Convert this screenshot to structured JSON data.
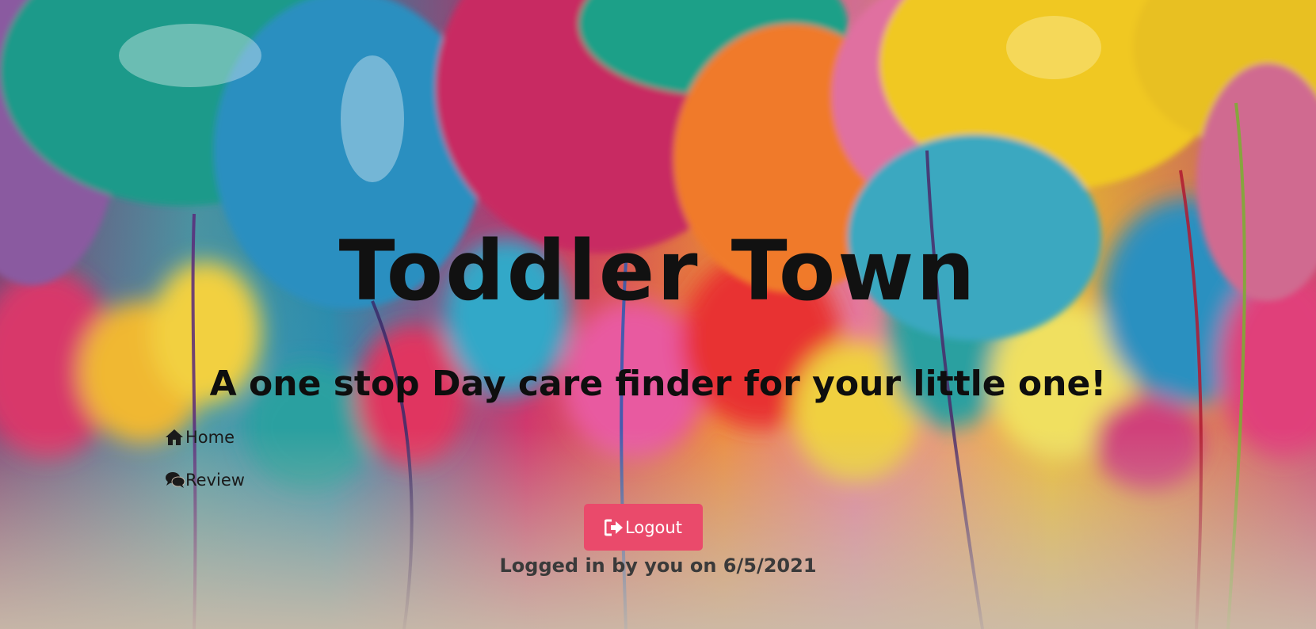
{
  "hero": {
    "title": "Toddler Town",
    "subtitle": "A one stop Day care finder for your little one!",
    "background": "balloons-photo"
  },
  "nav": {
    "items": [
      {
        "label": "Home",
        "icon": "home-icon"
      },
      {
        "label": "Review",
        "icon": "comments-icon"
      }
    ]
  },
  "actions": {
    "logout_label": "Logout",
    "logout_icon": "sign-out-icon",
    "logout_color": "#ea4a6b"
  },
  "status": {
    "text": "Logged in by you on 6/5/2021"
  }
}
